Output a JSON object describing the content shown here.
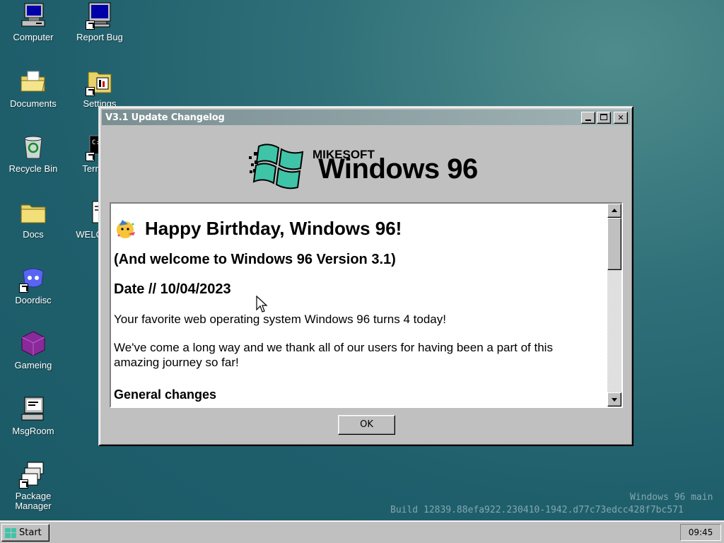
{
  "desktop": {
    "icons": [
      {
        "label": "Computer",
        "icon": "computer-icon"
      },
      {
        "label": "Report Bug",
        "icon": "monitor-icon"
      },
      {
        "label": "Documents",
        "icon": "folder-open-icon"
      },
      {
        "label": "Settings",
        "icon": "settings-icon"
      },
      {
        "label": "Recycle Bin",
        "icon": "recycle-bin-icon"
      },
      {
        "label": "Terminal",
        "icon": "terminal-icon"
      },
      {
        "label": "Docs",
        "icon": "folder-icon"
      },
      {
        "label": "WELCOME",
        "icon": "document-icon"
      },
      {
        "label": "Doordisc",
        "icon": "doordisc-icon"
      },
      {
        "label": "Gameing",
        "icon": "cube-icon"
      },
      {
        "label": "MsgRoom",
        "icon": "msgroom-icon"
      },
      {
        "label": "Package Manager",
        "icon": "package-manager-icon"
      }
    ]
  },
  "window": {
    "title": "V3.1 Update Changelog",
    "logo": {
      "brand_small": "MIKESOFT",
      "brand_large": "Windows 96"
    },
    "content": {
      "heading": "Happy Birthday, Windows 96!",
      "subheading": "(And welcome to Windows 96 Version 3.1)",
      "date": "Date // 10/04/2023",
      "para1": "Your favorite web operating system Windows 96 turns 4 today!",
      "para2": "We've come a long way and we thank all of our users for having been a part of this amazing journey so far!",
      "section": "General changes"
    },
    "ok_label": "OK",
    "buttons": {
      "minimize": "minimize",
      "maximize": "maximize",
      "close": "✕"
    }
  },
  "watermark": {
    "line1": "Windows 96 main",
    "line2": "Build 12839.88efa922.230410-1942.d77c73edcc428f7bc571"
  },
  "taskbar": {
    "start_label": "Start",
    "clock": "09:45"
  },
  "colors": {
    "desktop_bg": "#2e6f78",
    "titlebar": "#8fa3a6",
    "window_face": "#c0c0c0",
    "logo_teal": "#3fc4a8"
  }
}
